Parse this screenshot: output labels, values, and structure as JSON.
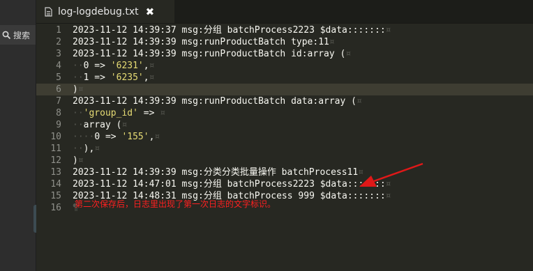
{
  "tab": {
    "title": "log-logdebug.txt",
    "close_glyph": "✖"
  },
  "sidebar": {
    "search_label": "搜索"
  },
  "lines": [
    {
      "n": "1",
      "parts": [
        {
          "t": "2023-11-12 14:39:37 msg:分组 batchProcess2223 $data:::::::",
          "c": "plain"
        },
        {
          "t": "¤",
          "c": "ws"
        }
      ]
    },
    {
      "n": "2",
      "parts": [
        {
          "t": "2023-11-12 14:39:39 msg:runProductBatch type:11",
          "c": "plain"
        },
        {
          "t": "¤",
          "c": "ws"
        }
      ]
    },
    {
      "n": "3",
      "parts": [
        {
          "t": "2023-11-12 14:39:39 msg:runProductBatch id:array (",
          "c": "plain"
        },
        {
          "t": "¤",
          "c": "ws"
        }
      ]
    },
    {
      "n": "4",
      "parts": [
        {
          "t": "··",
          "c": "ws"
        },
        {
          "t": "0 => ",
          "c": "plain"
        },
        {
          "t": "'6231'",
          "c": "str"
        },
        {
          "t": ",",
          "c": "plain"
        },
        {
          "t": "¤",
          "c": "ws"
        }
      ]
    },
    {
      "n": "5",
      "parts": [
        {
          "t": "··",
          "c": "ws"
        },
        {
          "t": "1 => ",
          "c": "plain"
        },
        {
          "t": "'6235'",
          "c": "str"
        },
        {
          "t": ",",
          "c": "plain"
        },
        {
          "t": "¤",
          "c": "ws"
        }
      ]
    },
    {
      "n": "6",
      "parts": [
        {
          "t": ")",
          "c": "plain"
        },
        {
          "t": "¤",
          "c": "ws"
        }
      ]
    },
    {
      "n": "7",
      "parts": [
        {
          "t": "2023-11-12 14:39:39 msg:runProductBatch data:array (",
          "c": "plain"
        },
        {
          "t": "¤",
          "c": "ws"
        }
      ]
    },
    {
      "n": "8",
      "parts": [
        {
          "t": "··",
          "c": "ws"
        },
        {
          "t": "'group_id'",
          "c": "str"
        },
        {
          "t": " =>",
          "c": "plain"
        },
        {
          "t": " ¤",
          "c": "ws"
        }
      ]
    },
    {
      "n": "9",
      "parts": [
        {
          "t": "··",
          "c": "ws"
        },
        {
          "t": "array (",
          "c": "plain"
        },
        {
          "t": "¤",
          "c": "ws"
        }
      ]
    },
    {
      "n": "10",
      "parts": [
        {
          "t": "····",
          "c": "ws"
        },
        {
          "t": "0 => ",
          "c": "plain"
        },
        {
          "t": "'155'",
          "c": "str"
        },
        {
          "t": ",",
          "c": "plain"
        },
        {
          "t": "¤",
          "c": "ws"
        }
      ]
    },
    {
      "n": "11",
      "parts": [
        {
          "t": "··",
          "c": "ws"
        },
        {
          "t": "),",
          "c": "plain"
        },
        {
          "t": "¤",
          "c": "ws"
        }
      ]
    },
    {
      "n": "12",
      "parts": [
        {
          "t": ")",
          "c": "plain"
        },
        {
          "t": "¤",
          "c": "ws"
        }
      ]
    },
    {
      "n": "13",
      "parts": [
        {
          "t": "2023-11-12 14:39:39 msg:分类分类批量操作 batchProcess11",
          "c": "plain"
        },
        {
          "t": "¤",
          "c": "ws"
        }
      ]
    },
    {
      "n": "14",
      "parts": [
        {
          "t": "2023-11-12 14:47:01 msg:分组 batchProcess2223 $data:::::::",
          "c": "plain"
        },
        {
          "t": "¤",
          "c": "ws"
        }
      ]
    },
    {
      "n": "15",
      "parts": [
        {
          "t": "2023-11-12 14:48:31 msg:分组 batchProcess 999 $data:::::::",
          "c": "plain"
        },
        {
          "t": "¤",
          "c": "ws"
        }
      ]
    },
    {
      "n": "16",
      "parts": [
        {
          "t": "¶",
          "c": "ws"
        }
      ]
    }
  ],
  "annotation": {
    "text": "第二次保存后，日志里出现了第一次日志的文字标识。",
    "color": "#ff2020"
  },
  "icons": {
    "file": "file-icon",
    "search": "search-icon",
    "collapse": "chevron-left-icon",
    "arrow": "red-arrow-icon"
  }
}
